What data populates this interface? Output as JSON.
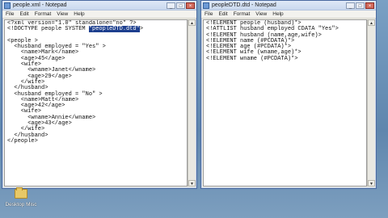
{
  "left_window": {
    "title": "people.xml - Notepad",
    "menu": [
      "File",
      "Edit",
      "Format",
      "View",
      "Help"
    ],
    "lines": [
      "<?xml version=\"1.0\" standalone=\"no\" ?>",
      "<!DOCTYPE people SYSTEM ",
      "",
      "<people >",
      "  <husband employed = \"Yes\" >",
      "    <name>Mark</name>",
      "    <age>45</age>",
      "    <wife>",
      "      <wname>Janet</wname>",
      "      <age>29</age>",
      "    </wife>",
      "  </husband>",
      "  <husband employed = \"No\" >",
      "    <name>Matt</name>",
      "    <age>42</age>",
      "    <wife>",
      "      <wname>Annie</wname>",
      "      <age>43</age>",
      "    </wife>",
      "  </husband>",
      "</people>"
    ],
    "doctype_selected": "\"peopleDTD.dtd\"",
    "doctype_end": ">"
  },
  "right_window": {
    "title": "peopleDTD.dtd - Notepad",
    "menu": [
      "File",
      "Edit",
      "Format",
      "View",
      "Help"
    ],
    "lines": [
      "<!ELEMENT people (husband)*>",
      "<!ATTLIST husband employed CDATA \"Yes\">",
      "<!ELEMENT husband (name,age,wife)>",
      "<!ELEMENT name (#PCDATA)*>",
      "<!ELEMENT age (#PCDATA)*>",
      "<!ELEMENT wife (wname,age)*>",
      "<!ELEMENT wname (#PCDATA)*>"
    ]
  },
  "window_buttons": {
    "minimize": "_",
    "maximize": "□",
    "close": "×"
  },
  "desktop_icon": {
    "label": "Desktop Misc"
  },
  "icons": {
    "app": "notepad-icon",
    "folder": "folder-icon",
    "scroll_up": "▲",
    "scroll_down": "▼"
  }
}
